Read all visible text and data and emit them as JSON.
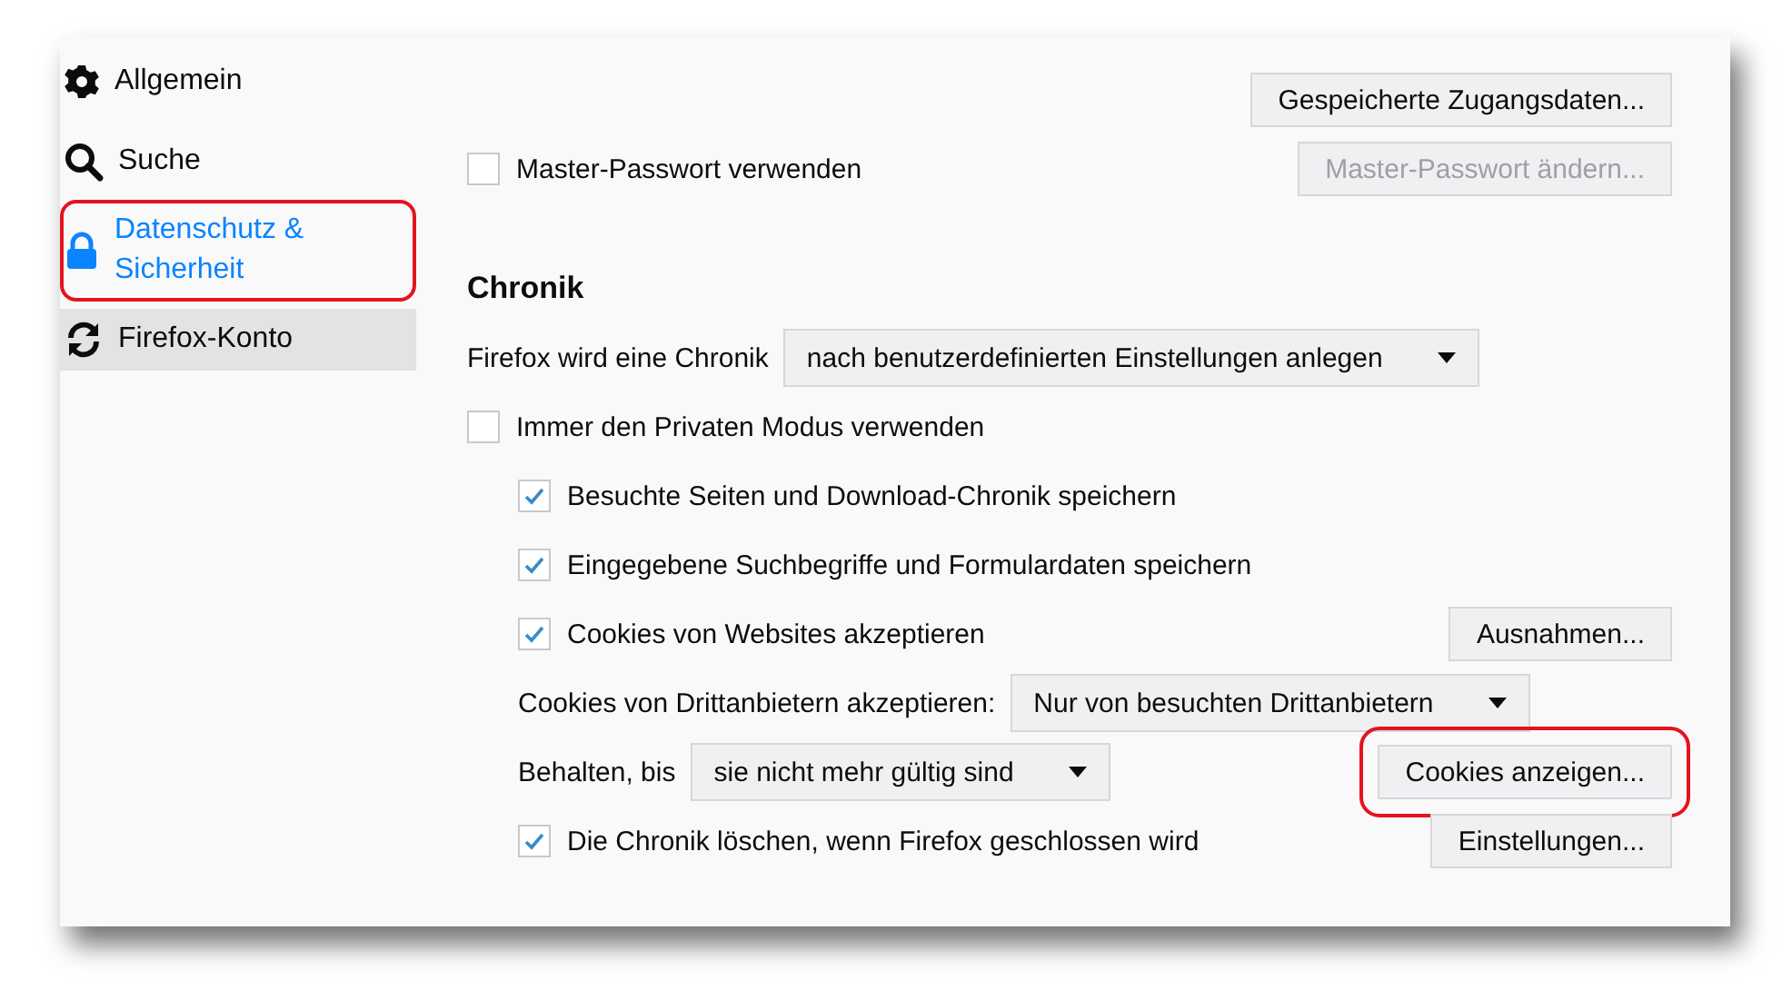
{
  "sidebar": {
    "items": [
      {
        "label": "Allgemein",
        "selected": false,
        "hovered": false,
        "highlighted": false
      },
      {
        "label": "Suche",
        "selected": false,
        "hovered": false,
        "highlighted": false
      },
      {
        "label": "Datenschutz & Sicherheit",
        "selected": true,
        "hovered": false,
        "highlighted": true
      },
      {
        "label": "Firefox-Konto",
        "selected": false,
        "hovered": true,
        "highlighted": false
      }
    ]
  },
  "content": {
    "rows": [
      {
        "kind": "button",
        "button": {
          "label": "Gespeicherte Zugangsdaten...",
          "disabled": false,
          "highlighted": false
        }
      },
      {
        "kind": "checkbox",
        "indented": false,
        "label": "Master-Passwort verwenden",
        "checked": false,
        "button": {
          "label": "Master-Passwort ändern...",
          "disabled": true,
          "highlighted": false
        }
      },
      {
        "kind": "heading",
        "indented": false,
        "label": "Chronik"
      },
      {
        "kind": "select",
        "indented": false,
        "label": "Firefox wird eine Chronik",
        "value": "nach benutzerdefinierten Einstellungen anlegen"
      },
      {
        "kind": "checkbox",
        "indented": false,
        "label": "Immer den Privaten Modus verwenden",
        "checked": false
      },
      {
        "kind": "checkbox",
        "indented": true,
        "label": "Besuchte Seiten und Download-Chronik speichern",
        "checked": true
      },
      {
        "kind": "checkbox",
        "indented": true,
        "label": "Eingegebene Suchbegriffe und Formulardaten speichern",
        "checked": true
      },
      {
        "kind": "checkbox",
        "indented": true,
        "label": "Cookies von Websites akzeptieren",
        "checked": true,
        "button": {
          "label": "Ausnahmen...",
          "disabled": false,
          "highlighted": false
        }
      },
      {
        "kind": "select",
        "indented": true,
        "label": "Cookies von Drittanbietern akzeptieren:",
        "value": "Nur von besuchten Drittanbietern"
      },
      {
        "kind": "select",
        "indented": true,
        "label": "Behalten, bis",
        "value": "sie nicht mehr gültig sind",
        "button": {
          "label": "Cookies anzeigen...",
          "disabled": false,
          "highlighted": true
        }
      },
      {
        "kind": "checkbox",
        "indented": true,
        "label": "Die Chronik löschen, wenn Firefox geschlossen wird",
        "checked": true,
        "button": {
          "label": "Einstellungen...",
          "disabled": false,
          "highlighted": false
        }
      }
    ]
  }
}
